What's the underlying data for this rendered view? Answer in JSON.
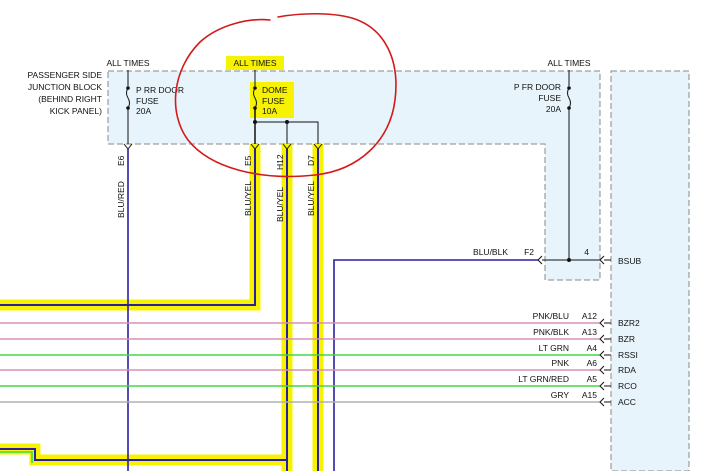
{
  "colors": {
    "block_fill": "#e8f4fb",
    "block_border": "#888888",
    "highlight": "#f7f200",
    "annotation": "#d21a1a",
    "wire_blue": "#2a1f9e",
    "wire_black": "#111111",
    "wire_pink": "#d98fb6",
    "wire_green": "#44d844",
    "wire_gray": "#b0b0b0"
  },
  "junction_block": {
    "label_lines": [
      "PASSENGER SIDE",
      "JUNCTION BLOCK",
      "(BEHIND RIGHT",
      "KICK PANEL)"
    ]
  },
  "fuses": [
    {
      "header": "ALL TIMES",
      "name_lines": [
        "P RR DOOR",
        "FUSE",
        "20A"
      ],
      "highlighted": false
    },
    {
      "header": "ALL TIMES",
      "name_lines": [
        "DOME",
        "FUSE",
        "10A"
      ],
      "highlighted": true
    },
    {
      "header": "ALL TIMES",
      "name_lines": [
        "P FR DOOR",
        "FUSE",
        "20A"
      ],
      "highlighted": false
    }
  ],
  "vertical_wires": [
    {
      "pin": "E6",
      "color_code": "BLU/RED",
      "highlighted": false
    },
    {
      "pin": "E5",
      "color_code": "BLU/YEL",
      "highlighted": true
    },
    {
      "pin": "H12",
      "color_code": "BLU/YEL",
      "highlighted": true
    },
    {
      "pin": "D7",
      "color_code": "BLU/YEL",
      "highlighted": true
    }
  ],
  "bsub": {
    "wire_label": "BLU/BLK",
    "pin": "F2",
    "fuse_pin": "4",
    "connector": "BSUB"
  },
  "horizontal_wires": [
    {
      "label": "PNK/BLU",
      "pin": "A12",
      "connector": "BZR2",
      "color": "#d98fb6"
    },
    {
      "label": "PNK/BLK",
      "pin": "A13",
      "connector": "BZR",
      "color": "#d98fb6"
    },
    {
      "label": "LT GRN",
      "pin": "A4",
      "connector": "RSSI",
      "color": "#44d844"
    },
    {
      "label": "PNK",
      "pin": "A6",
      "connector": "RDA",
      "color": "#d98fb6"
    },
    {
      "label": "LT GRN/RED",
      "pin": "A5",
      "connector": "RCO",
      "color": "#44d844"
    },
    {
      "label": "GRY",
      "pin": "A15",
      "connector": "ACC",
      "color": "#b0b0b0"
    }
  ]
}
